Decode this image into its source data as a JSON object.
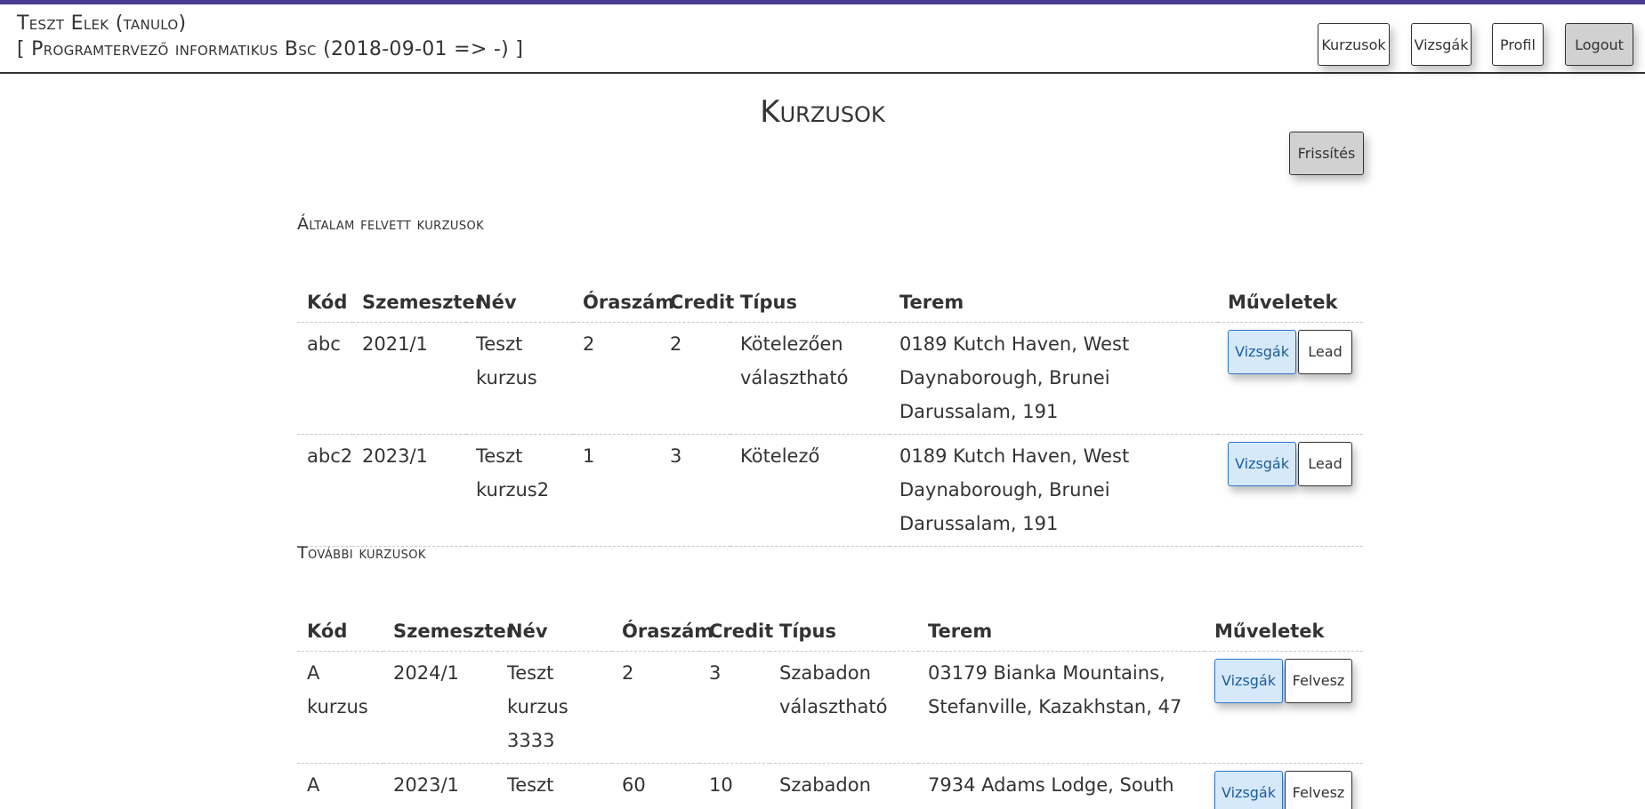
{
  "header": {
    "user_name": "Teszt Elek (tanulo)",
    "user_program": "[ Programtervező informatikus Bsc (2018-09-01 => -) ]",
    "nav": {
      "courses": "Kurzusok",
      "exams": "Vizsgák",
      "profile": "Profil",
      "logout": "Logout"
    }
  },
  "page": {
    "title": "Kurzusok",
    "refresh": "Frissítés"
  },
  "columns": [
    "Kód",
    "Szemeszter",
    "Név",
    "Óraszám",
    "Credit",
    "Típus",
    "Terem",
    "Műveletek"
  ],
  "enrolled": {
    "title": "Általam felvett kurzusok",
    "rows": [
      {
        "code": "abc",
        "semester": "2021/1",
        "name": "Teszt kurzus",
        "hours": "2",
        "credit": "2",
        "type": "Kötelezően választható",
        "room": "0189 Kutch Haven, West Daynaborough, Brunei Darussalam, 191",
        "exams_btn": "Vizsgák",
        "action_btn": "Lead"
      },
      {
        "code": "abc2",
        "semester": "2023/1",
        "name": "Teszt kurzus2",
        "hours": "1",
        "credit": "3",
        "type": "Kötelező",
        "room": "0189 Kutch Haven, West Daynaborough, Brunei Darussalam, 191",
        "exams_btn": "Vizsgák",
        "action_btn": "Lead"
      }
    ]
  },
  "other": {
    "title": "További kurzusok",
    "rows": [
      {
        "code": "A kurzus",
        "semester": "2024/1",
        "name": "Teszt kurzus 3333",
        "hours": "2",
        "credit": "3",
        "type": "Szabadon választható",
        "room": "03179 Bianka Mountains, Stefanville, Kazakhstan, 47",
        "exams_btn": "Vizsgák",
        "action_btn": "Felvesz"
      },
      {
        "code": "A",
        "semester": "2023/1",
        "name": "Teszt",
        "hours": "60",
        "credit": "10",
        "type": "Szabadon",
        "room": "7934 Adams Lodge, South",
        "exams_btn": "Vizsgák",
        "action_btn": "Felvesz"
      }
    ]
  }
}
